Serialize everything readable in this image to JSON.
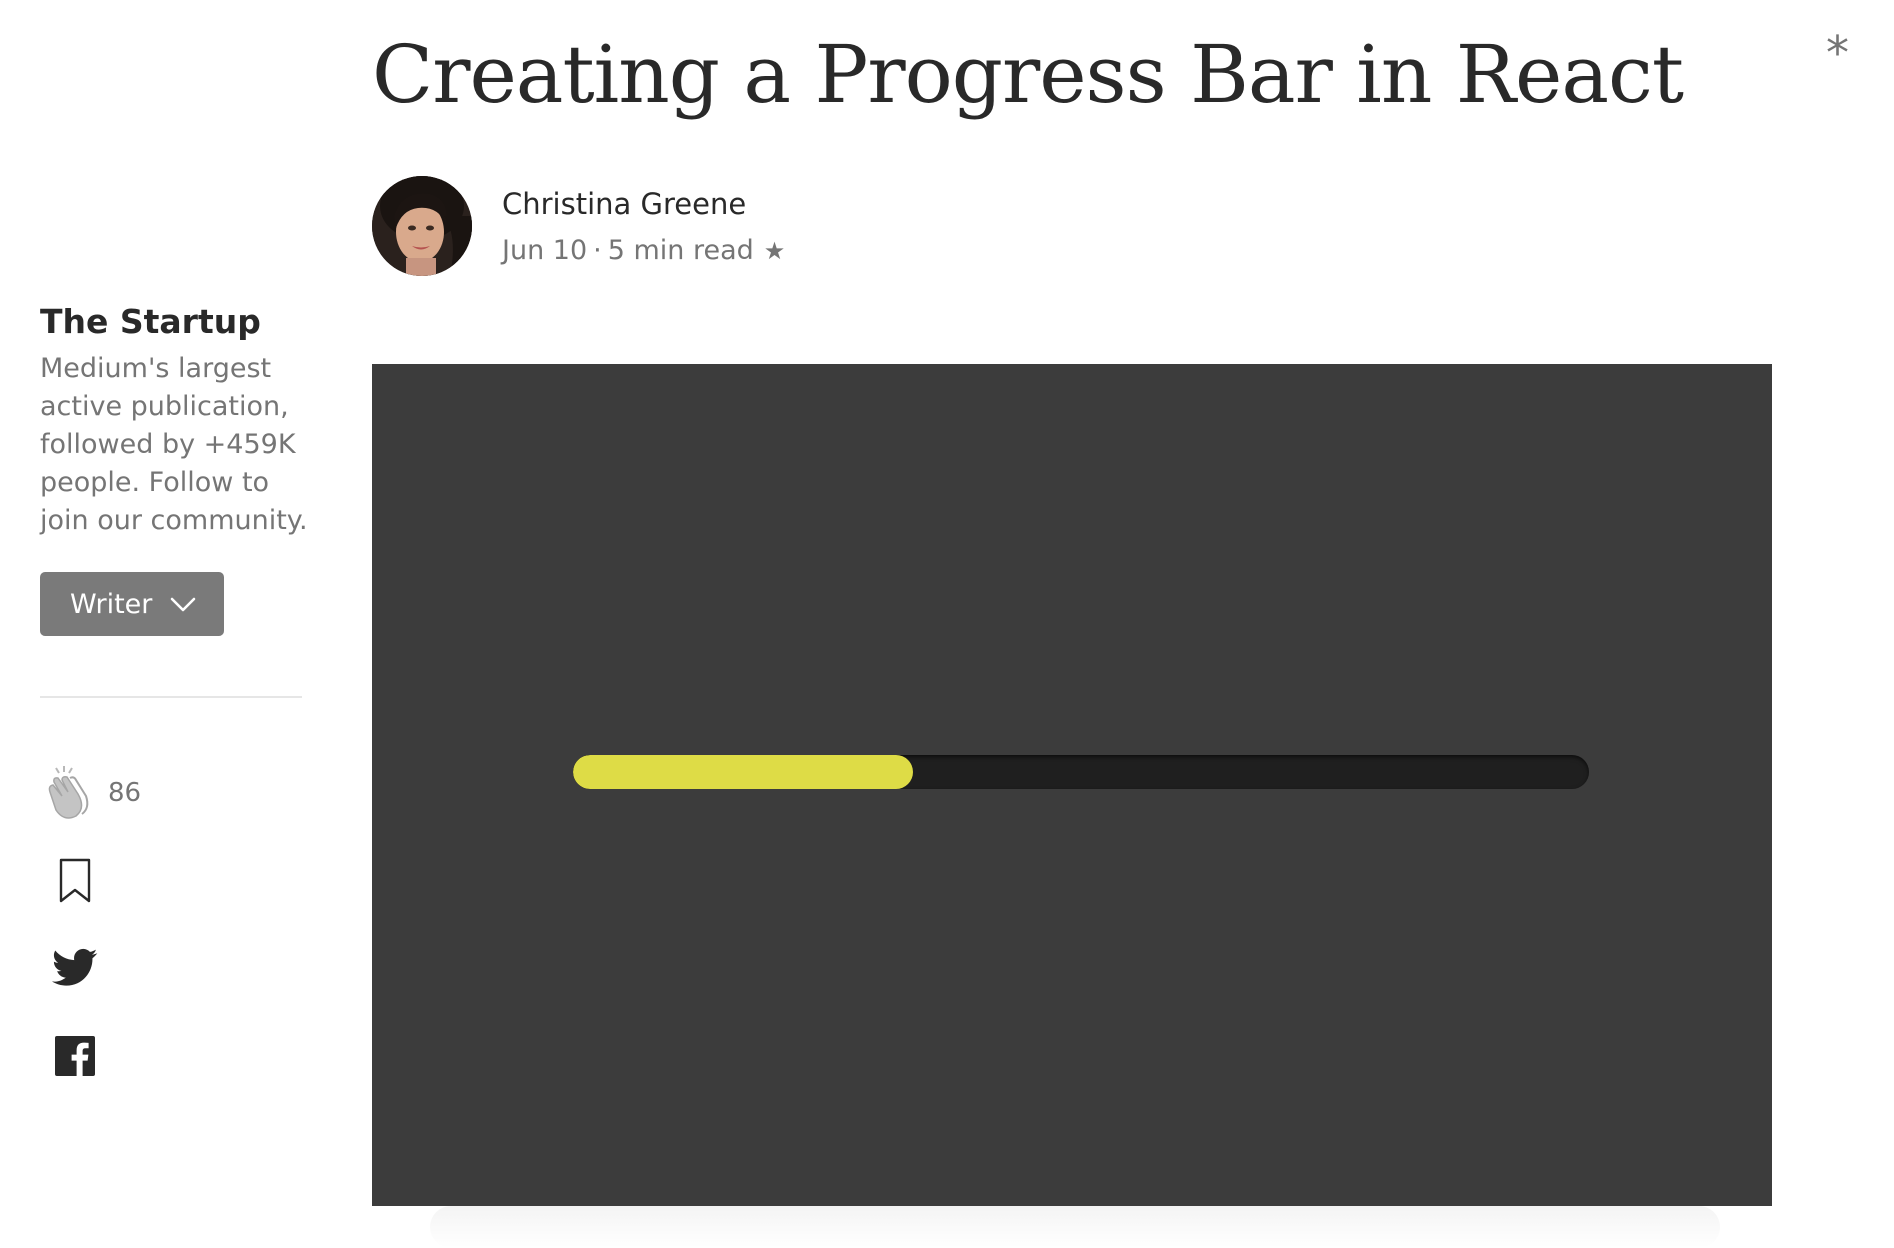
{
  "article": {
    "title": "Creating a Progress Bar in React",
    "corner_icon": "asterisk-icon",
    "corner_glyph": "*"
  },
  "author": {
    "name": "Christina Greene",
    "date": "Jun 10",
    "separator": "·",
    "read_time": "5 min read",
    "star": "★",
    "avatar_icon": "author-avatar"
  },
  "publication": {
    "name": "The Startup",
    "description": "Medium's largest active publication, followed by +459K people. Follow to join our community.",
    "writer_button_label": "Writer"
  },
  "actions": {
    "clap_count": "86",
    "icons": [
      "clap-icon",
      "bookmark-icon",
      "twitter-icon",
      "facebook-icon"
    ]
  },
  "hero": {
    "background_color": "#3c3c3c",
    "track_color": "#1f1f1f",
    "fill_color": "#dedc46",
    "progress_fraction": 0.335
  }
}
